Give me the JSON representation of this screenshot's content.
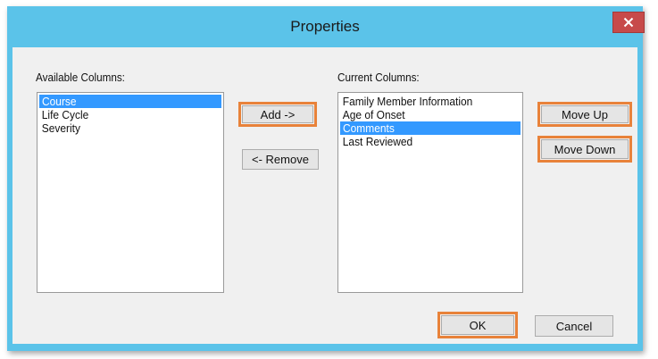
{
  "window": {
    "title": "Properties",
    "close_glyph": "✕"
  },
  "available": {
    "label": "Available Columns:",
    "items": [
      "Course",
      "Life Cycle",
      "Severity"
    ],
    "selected_index": 0
  },
  "current": {
    "label": "Current Columns:",
    "items": [
      "Family Member Information",
      "Age of Onset",
      "Comments",
      "Last Reviewed"
    ],
    "selected_index": 2
  },
  "buttons": {
    "add": "Add ->",
    "remove": "<- Remove",
    "move_up": "Move Up",
    "move_down": "Move Down",
    "ok": "OK",
    "cancel": "Cancel"
  },
  "colors": {
    "titlebar": "#5bc3e9",
    "selection": "#3399ff",
    "highlight": "#e8823a",
    "close": "#c74a4a"
  },
  "icons": {
    "close": "close-icon"
  }
}
